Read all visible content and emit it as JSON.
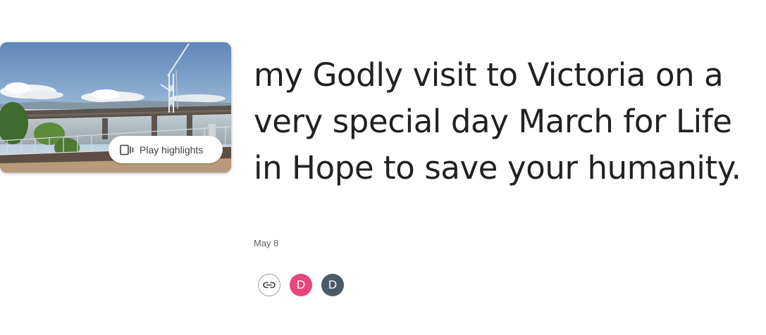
{
  "cover": {
    "play_label": "Play highlights",
    "play_icon": "slideshow-icon"
  },
  "title": "my Godly visit to Victoria on a very special day March for Life in Hope to save your humanity.",
  "date": "May 8",
  "actions": {
    "link_icon": "link-icon",
    "avatars": [
      {
        "initial": "D",
        "color": "#e8457a"
      },
      {
        "initial": "D",
        "color": "#4a5a66"
      }
    ]
  },
  "colors": {
    "title": "#202124",
    "secondary_text": "#5f6368"
  }
}
